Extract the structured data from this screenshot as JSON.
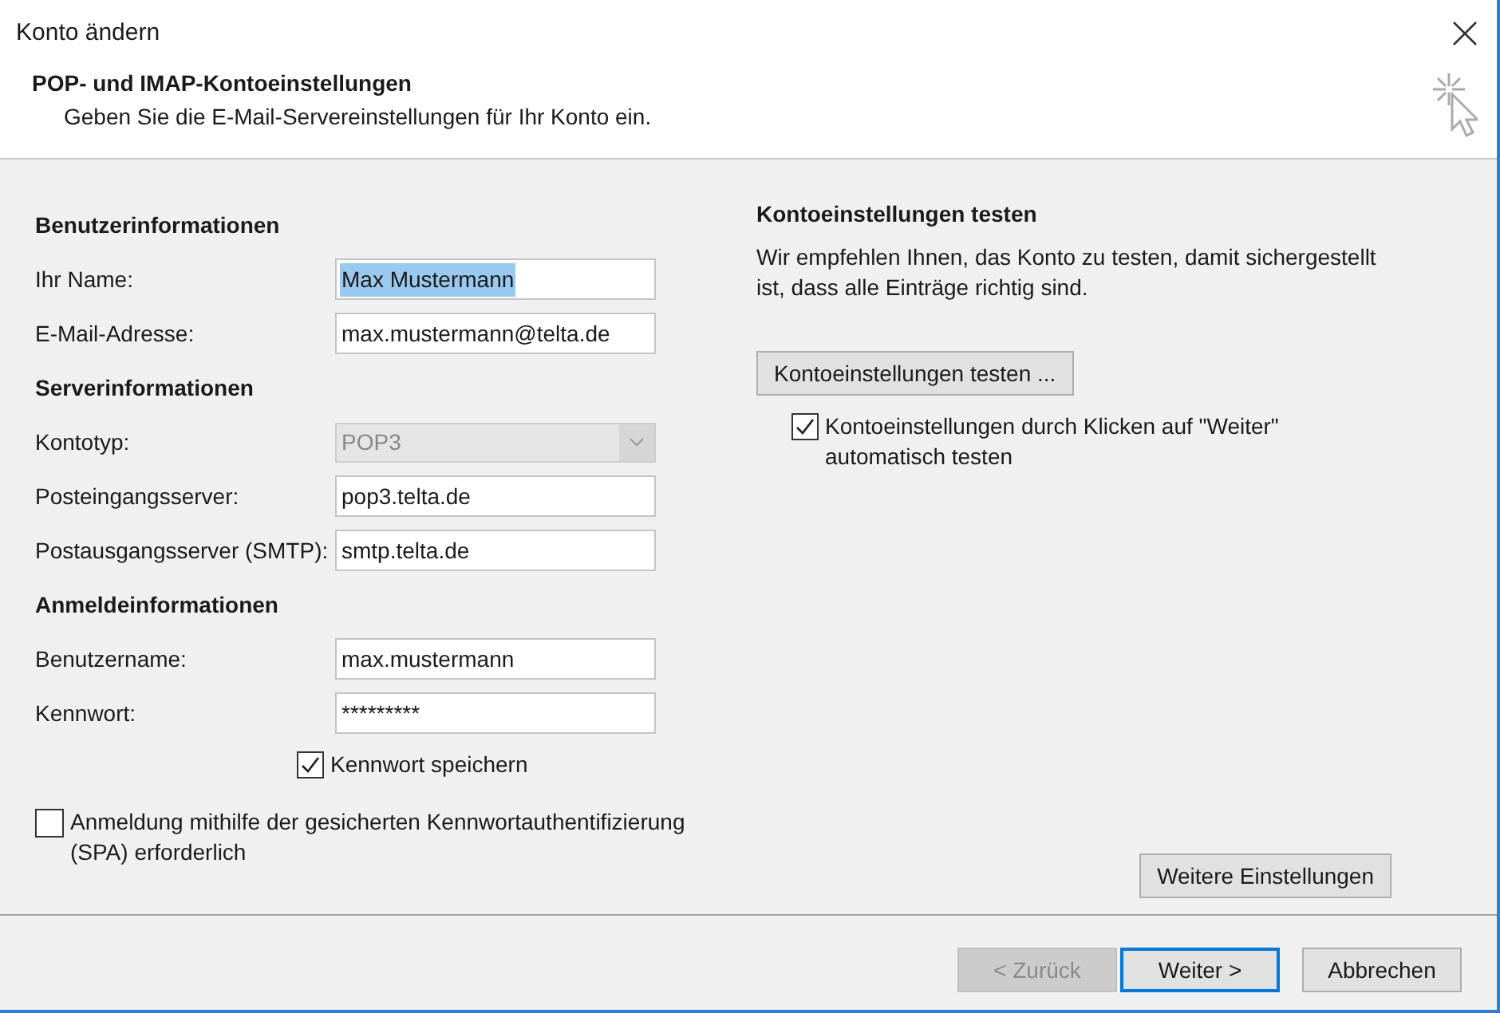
{
  "window": {
    "title": "Konto ändern"
  },
  "header": {
    "title": "POP- und IMAP-Kontoeinstellungen",
    "subtitle": "Geben Sie die E-Mail-Servereinstellungen für Ihr Konto ein."
  },
  "sections": [
    {
      "heading": "Benutzerinformationen",
      "fields": [
        {
          "kind": "text",
          "label": "Ihr Name:",
          "value": "Max Mustermann",
          "text_selected": true
        },
        {
          "kind": "text",
          "label": "E-Mail-Adresse:",
          "value": "max.mustermann@telta.de",
          "text_selected": false
        }
      ]
    },
    {
      "heading": "Serverinformationen",
      "fields": [
        {
          "kind": "dropdown",
          "label": "Kontotyp:",
          "value": "POP3",
          "disabled": true
        },
        {
          "kind": "text",
          "label": "Posteingangsserver:",
          "value": "pop3.telta.de",
          "text_selected": false
        },
        {
          "kind": "text",
          "label": "Postausgangsserver (SMTP):",
          "value": "smtp.telta.de",
          "text_selected": false
        }
      ]
    },
    {
      "heading": "Anmeldeinformationen",
      "fields": [
        {
          "kind": "text",
          "label": "Benutzername:",
          "value": "max.mustermann",
          "text_selected": false
        },
        {
          "kind": "password",
          "label": "Kennwort:",
          "value": "*********",
          "text_selected": false
        }
      ]
    }
  ],
  "remember_password": {
    "label": "Kennwort speichern",
    "checked": true
  },
  "spa": {
    "label": "Anmeldung mithilfe der gesicherten Kennwortauthentifizierung (SPA) erforderlich",
    "checked": false
  },
  "test": {
    "heading": "Kontoeinstellungen testen",
    "description": "Wir empfehlen Ihnen, das Konto zu testen, damit sichergestellt ist, dass alle Einträge richtig sind.",
    "button": "Kontoeinstellungen testen ...",
    "auto_test": {
      "label": "Kontoeinstellungen durch Klicken auf \"Weiter\" automatisch testen",
      "checked": true
    }
  },
  "more_settings": "Weitere Einstellungen",
  "buttons": [
    {
      "label": "< Zurück",
      "disabled": true,
      "default": false
    },
    {
      "label": "Weiter >",
      "disabled": false,
      "default": true
    },
    {
      "label": "Abbrechen",
      "disabled": false,
      "default": false
    }
  ]
}
